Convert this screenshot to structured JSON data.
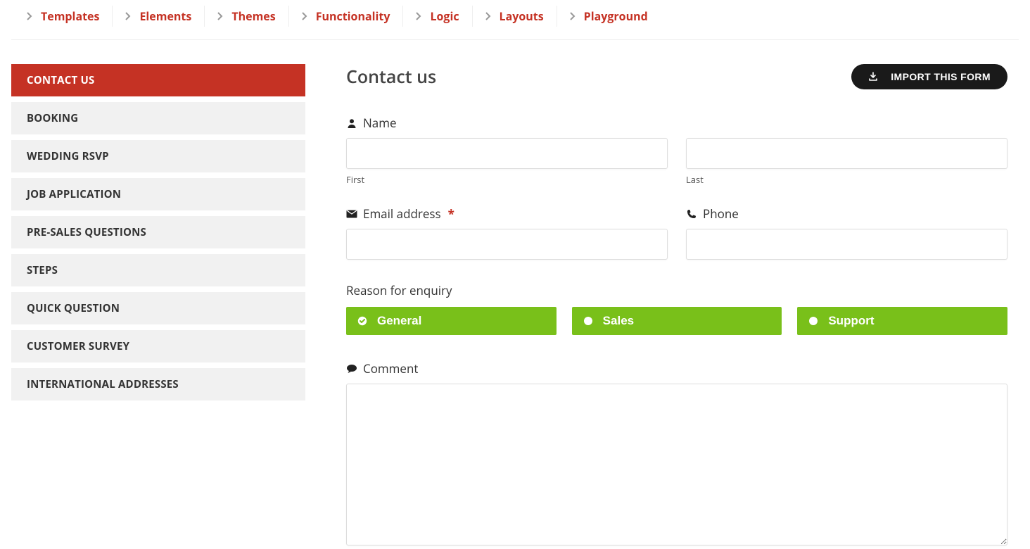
{
  "nav": {
    "items": [
      {
        "label": "Templates"
      },
      {
        "label": "Elements"
      },
      {
        "label": "Themes"
      },
      {
        "label": "Functionality"
      },
      {
        "label": "Logic"
      },
      {
        "label": "Layouts"
      },
      {
        "label": "Playground"
      }
    ]
  },
  "sidebar": {
    "items": [
      {
        "label": "CONTACT US",
        "active": true
      },
      {
        "label": "BOOKING"
      },
      {
        "label": "WEDDING RSVP"
      },
      {
        "label": "JOB APPLICATION"
      },
      {
        "label": "PRE-SALES QUESTIONS"
      },
      {
        "label": "STEPS"
      },
      {
        "label": "QUICK QUESTION"
      },
      {
        "label": "CUSTOMER SURVEY"
      },
      {
        "label": "INTERNATIONAL ADDRESSES"
      }
    ]
  },
  "header": {
    "title": "Contact us",
    "import_label": "IMPORT THIS FORM"
  },
  "form": {
    "name": {
      "label": "Name",
      "first_sub": "First",
      "last_sub": "Last",
      "first_value": "",
      "last_value": ""
    },
    "email": {
      "label": "Email address",
      "required": "*",
      "value": ""
    },
    "phone": {
      "label": "Phone",
      "value": ""
    },
    "reason": {
      "label": "Reason for enquiry",
      "options": [
        {
          "label": "General",
          "selected": true
        },
        {
          "label": "Sales",
          "selected": false
        },
        {
          "label": "Support",
          "selected": false
        }
      ]
    },
    "comment": {
      "label": "Comment",
      "value": ""
    }
  }
}
